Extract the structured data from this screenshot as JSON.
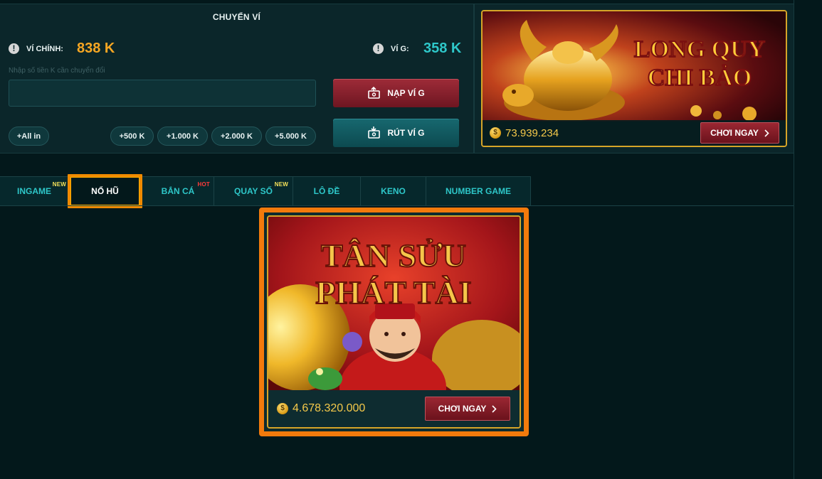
{
  "wallet": {
    "title": "CHUYỂN VÍ",
    "main_label": "VÍ CHÍNH:",
    "main_balance": "838 K",
    "g_label": "VÍ G:",
    "g_balance": "358 K",
    "input_hint": "Nhập số tiền K cần chuyển đổi",
    "input_value": "",
    "deposit_label": "NẠP VÍ G",
    "withdraw_label": "RÚT VÍ G",
    "all_in_label": "+All in",
    "quick_amounts": [
      "+500 K",
      "+1.000 K",
      "+2.000 K",
      "+5.000 K"
    ]
  },
  "featured_game": {
    "title_line1": "LONG QUY",
    "title_line2": "CHI BẢO",
    "jackpot": "73.939.234",
    "play_label": "CHƠI NGAY"
  },
  "tabs": [
    {
      "label": "INGAME",
      "badge": "NEW"
    },
    {
      "label": "NỔ HŨ",
      "badge": ""
    },
    {
      "label": "BẮN CÁ",
      "badge": "HOT"
    },
    {
      "label": "QUAY SỐ",
      "badge": "NEW"
    },
    {
      "label": "LÔ ĐỀ",
      "badge": ""
    },
    {
      "label": "KENO",
      "badge": ""
    },
    {
      "label": "NUMBER GAME",
      "badge": ""
    }
  ],
  "active_tab": "NỔ HŨ",
  "main_game": {
    "title_line1": "TÂN SỬU",
    "title_line2": "PHÁT TÀI",
    "jackpot": "4.678.320.000",
    "play_label": "CHƠI NGAY"
  },
  "icons": {
    "warning": "warning-icon",
    "transfer": "wallet-transfer-icon",
    "coin": "coin-icon",
    "chevron": "chevron-right-icon"
  },
  "colors": {
    "background": "#03181b",
    "accent_orange": "#f08a00",
    "balance_orange": "#f6a623",
    "balance_teal": "#2ec7c9",
    "tab_text": "#2ec7c9",
    "button_red": "#8c1f2b",
    "button_teal": "#115a60",
    "new_badge": "#f3e15a",
    "hot_badge": "#ff3b3b"
  }
}
